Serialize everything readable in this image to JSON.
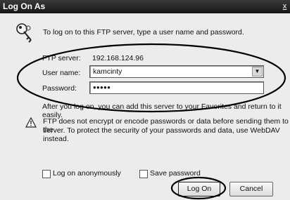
{
  "dialog": {
    "title": "Log On As",
    "close_glyph": "x",
    "intro": "To log on to this FTP server, type a user name and password."
  },
  "form": {
    "server_label": "FTP server:",
    "server_value": "192.168.124.96",
    "user_label": "User name:",
    "user_value": "kamcinty",
    "password_label": "Password:",
    "password_mask": "•••••"
  },
  "info": {
    "after_text": "After you log on, you can add this server to your Favorites and return to it easily.",
    "warning_line1": "FTP does not encrypt or encode passwords or data before sending them to the",
    "warning_line2": "server.  To protect the security of your passwords and data, use WebDAV instead."
  },
  "options": {
    "anonymous_label": "Log on anonymously",
    "save_label": "Save password"
  },
  "buttons": {
    "logon_label": "Log On",
    "cancel_label": "Cancel"
  },
  "icons": {
    "key": "key-icon",
    "warning": "warning-icon",
    "dropdown": "chevron-down-icon"
  }
}
